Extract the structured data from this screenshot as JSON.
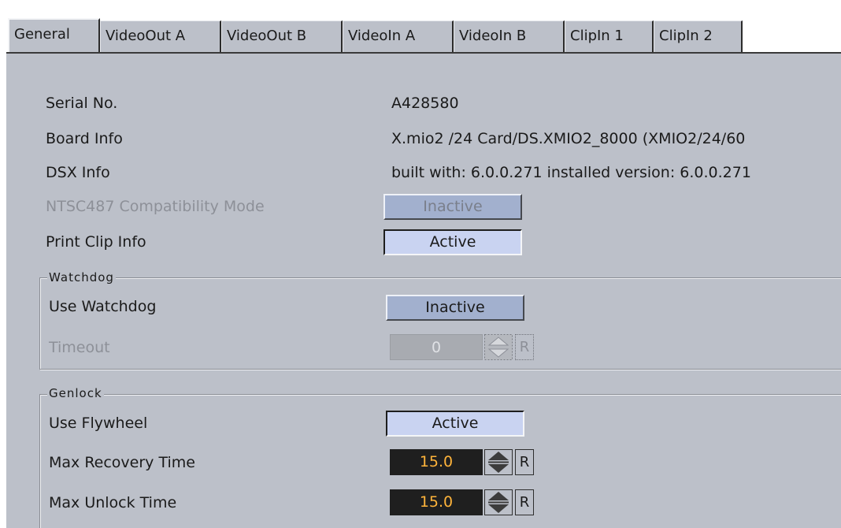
{
  "tabs": [
    {
      "label": "General",
      "active": true
    },
    {
      "label": "VideoOut A",
      "active": false
    },
    {
      "label": "VideoOut B",
      "active": false
    },
    {
      "label": "VideoIn A",
      "active": false
    },
    {
      "label": "VideoIn B",
      "active": false
    },
    {
      "label": "ClipIn 1",
      "active": false
    },
    {
      "label": "ClipIn 2",
      "active": false
    }
  ],
  "info": {
    "serial_label": "Serial No.",
    "serial_value": "A428580",
    "board_label": "Board Info",
    "board_value": "X.mio2 /24 Card/DS.XMIO2_8000 (XMIO2/24/60",
    "dsx_label": "DSX Info",
    "dsx_value": "built with: 6.0.0.271 installed version: 6.0.0.271",
    "ntsc_label": "NTSC487 Compatibility Mode",
    "ntsc_value": "Inactive",
    "print_label": "Print Clip Info",
    "print_value": "Active"
  },
  "watchdog": {
    "title": "Watchdog",
    "use_label": "Use Watchdog",
    "use_value": "Inactive",
    "timeout_label": "Timeout",
    "timeout_value": "0",
    "timeout_reset": "R"
  },
  "genlock": {
    "title": "Genlock",
    "flywheel_label": "Use Flywheel",
    "flywheel_value": "Active",
    "recovery_label": "Max Recovery Time",
    "recovery_value": "15.0",
    "recovery_reset": "R",
    "unlock_label": "Max Unlock Time",
    "unlock_value": "15.0",
    "unlock_reset": "R"
  },
  "colors": {
    "panel": "#bcc0c9",
    "button_inactive": "#a2b0ce",
    "button_active": "#c9d3f1",
    "numeric_bg": "#1f1f1f",
    "numeric_text": "#ffb43b"
  },
  "icons": {
    "spinner": "up-down-arrows-icon",
    "reset": "reset-button"
  }
}
